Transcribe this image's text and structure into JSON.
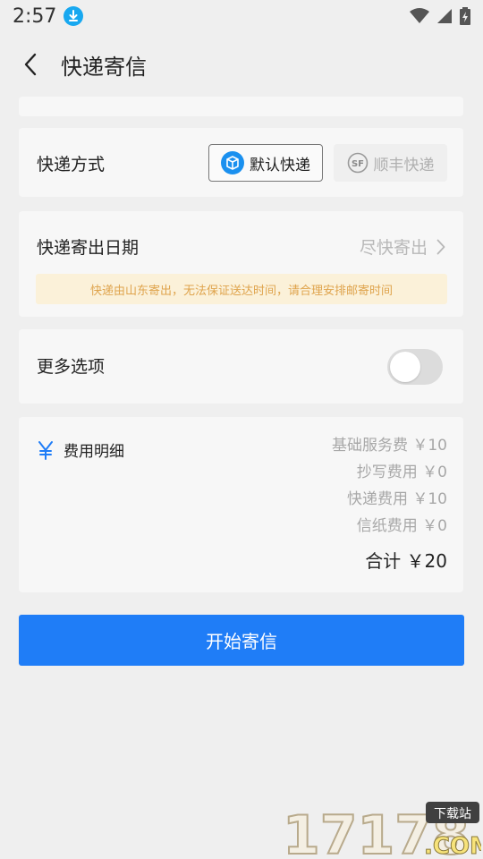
{
  "status_bar": {
    "time": "2:57"
  },
  "header": {
    "title": "快递寄信"
  },
  "delivery": {
    "label": "快递方式",
    "options": [
      {
        "label": "默认快递",
        "selected": true
      },
      {
        "label": "顺丰快递",
        "selected": false
      }
    ]
  },
  "date": {
    "label": "快递寄出日期",
    "value": "尽快寄出",
    "notice": "快递由山东寄出，无法保证送达时间，请合理安排邮寄时间"
  },
  "more": {
    "label": "更多选项",
    "toggle_on": false
  },
  "fees": {
    "title": "费用明细",
    "currency_symbol": "¥",
    "lines": [
      "基础服务费 ￥10",
      "抄写费用 ￥0",
      "快递费用 ￥10",
      "信纸费用 ￥0"
    ],
    "total": "合计 ￥20"
  },
  "action": {
    "start_label": "开始寄信"
  },
  "watermark": {
    "number": "17178",
    "badge": "下载站",
    "suffix": ".COM"
  },
  "colors": {
    "accent": "#1f7df7",
    "notice_bg": "#fbf1d9",
    "notice_text": "#dfa44d",
    "card_bg": "#f7f7f7",
    "page_bg": "#efefef"
  }
}
